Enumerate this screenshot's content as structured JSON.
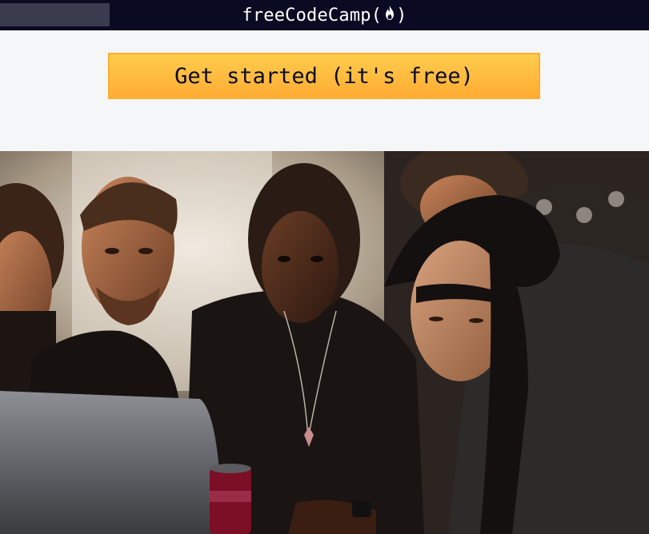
{
  "navbar": {
    "brand_text": "freeCodeCamp(",
    "brand_close": ")",
    "flame_icon": "fire-icon",
    "background": "#0a0a23"
  },
  "hero": {
    "cta_label": "Get started (it's free)",
    "cta_color": "#feac32"
  },
  "photo": {
    "subject": "people-gathered-around-laptop"
  }
}
